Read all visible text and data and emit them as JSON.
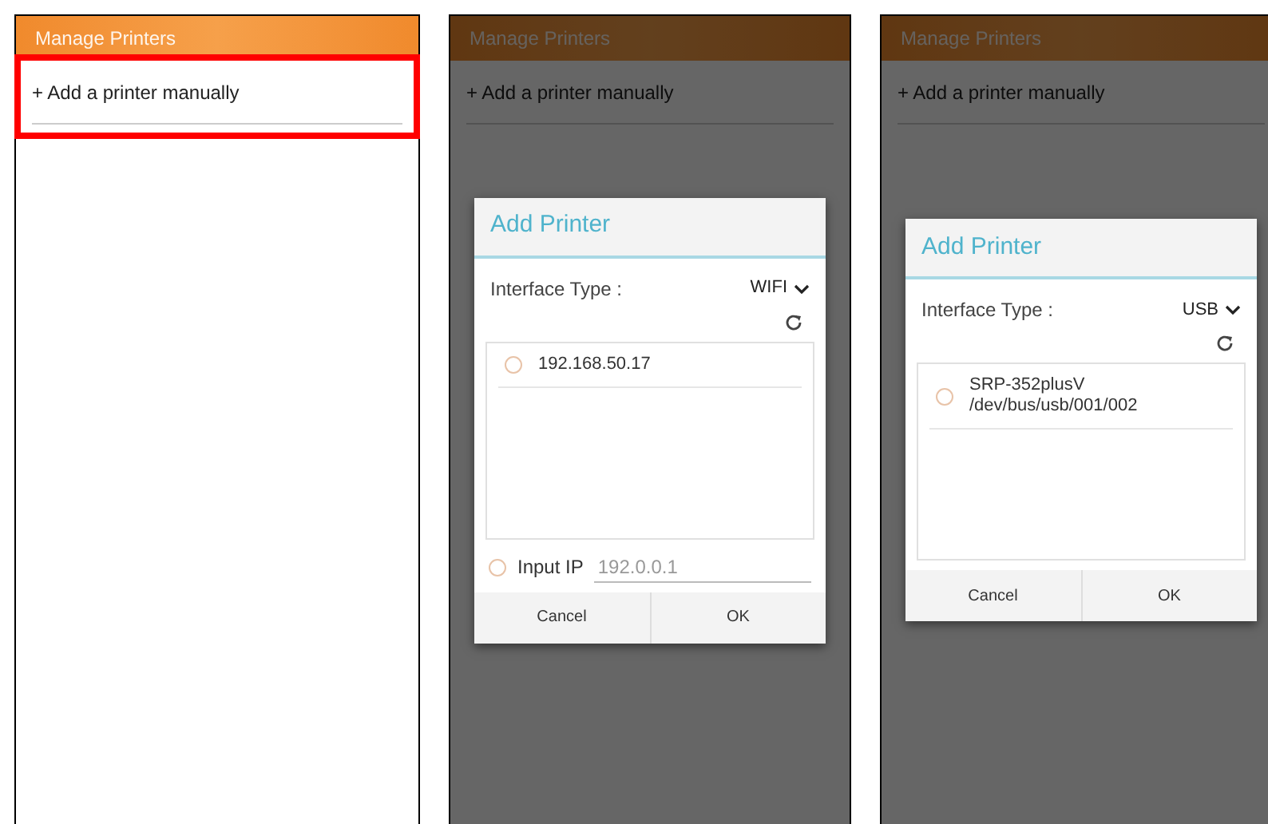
{
  "screens": [
    {
      "title": "Manage Printers",
      "add_item": "+ Add a printer manually",
      "highlighted": true
    },
    {
      "title": "Manage Printers",
      "add_item": "+ Add a printer manually",
      "highlighted": false,
      "dialog": {
        "title": "Add Printer",
        "interface_label": "Interface Type :",
        "interface_value": "WIFI",
        "printers": [
          {
            "lines": [
              "192.168.50.17"
            ],
            "selected": false
          }
        ],
        "input_ip": {
          "label": "Input IP",
          "placeholder": "192.0.0.1",
          "selected": false
        },
        "buttons": [
          "Cancel",
          "OK"
        ]
      }
    },
    {
      "title": "Manage Printers",
      "add_item": "+ Add a printer manually",
      "highlighted": false,
      "dialog": {
        "title": "Add Printer",
        "interface_label": "Interface Type :",
        "interface_value": "USB",
        "printers": [
          {
            "lines": [
              "SRP-352plusV",
              "/dev/bus/usb/001/002"
            ],
            "selected": false
          }
        ],
        "buttons": [
          "Cancel",
          "OK"
        ]
      }
    }
  ]
}
